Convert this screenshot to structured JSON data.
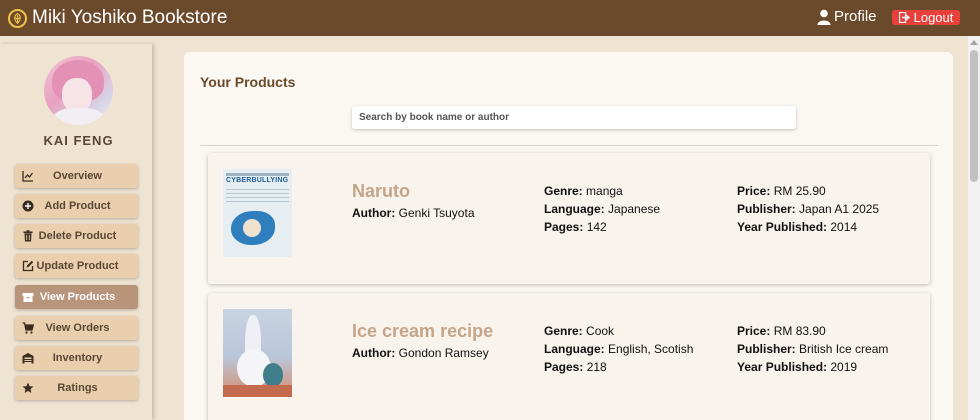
{
  "header": {
    "title": "Miki Yoshiko Bookstore",
    "logo_icon": "leaf-icon",
    "profile_label": "Profile",
    "logout_label": "Logout",
    "bar_color": "#6b4a2b",
    "logout_color": "#e8413c"
  },
  "sidebar": {
    "user_name": "KAI FENG",
    "items": [
      {
        "label": "Overview",
        "icon": "chart-line-icon",
        "active": false
      },
      {
        "label": "Add Product",
        "icon": "plus-circle-icon",
        "active": false
      },
      {
        "label": "Delete Product",
        "icon": "trash-icon",
        "active": false
      },
      {
        "label": "Update Product",
        "icon": "edit-icon",
        "active": false
      },
      {
        "label": "View Products",
        "icon": "box-icon",
        "active": true
      },
      {
        "label": "View Orders",
        "icon": "cart-icon",
        "active": false
      },
      {
        "label": "Inventory",
        "icon": "warehouse-icon",
        "active": false
      },
      {
        "label": "Ratings",
        "icon": "star-icon",
        "active": false
      }
    ]
  },
  "main": {
    "title": "Your Products",
    "search_placeholder": "Search by book name or author",
    "labels": {
      "author": "Author:",
      "genre": "Genre:",
      "language": "Language:",
      "pages": "Pages:",
      "price": "Price:",
      "publisher": "Publisher:",
      "year": "Year Published:"
    },
    "products": [
      {
        "title": "Naruto",
        "cover_text": "CYBERBULLYING",
        "author": "Genki Tsuyota",
        "genre": "manga",
        "language": "Japanese",
        "pages": "142",
        "price": "RM 25.90",
        "publisher": "Japan A1 2025",
        "year": "2014"
      },
      {
        "title": "Ice cream recipe",
        "author": "Gondon Ramsey",
        "genre": "Cook",
        "language": "English, Scotish",
        "pages": "218",
        "price": "RM 83.90",
        "publisher": "British Ice cream",
        "year": "2019"
      }
    ]
  }
}
